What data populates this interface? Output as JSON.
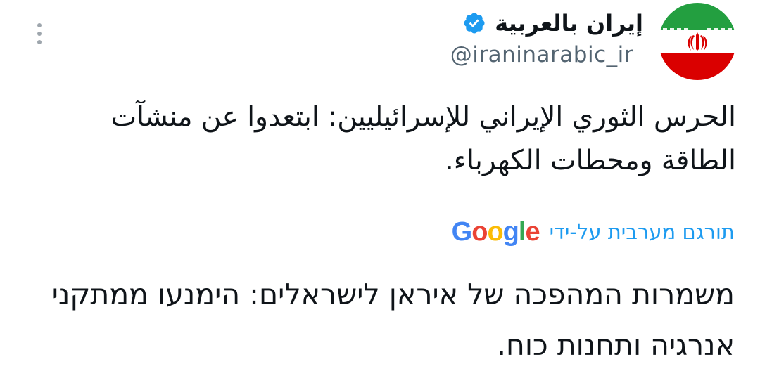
{
  "account": {
    "display_name": "إيران بالعربية",
    "handle": "@iraninarabic_ir",
    "verified": true,
    "avatar": "iran-flag-avatar"
  },
  "tweet": {
    "text": "الحرس الثوري الإيراني للإسرائيليين: ابتعدوا عن منشآت الطاقة ومحطات الكهرباء.",
    "translated_by_label": "תורגם מערבית על-ידי",
    "translation_provider": "Google",
    "translation": "משמרות המהפכה של איראן לישראלים: הימנעו ממתקני אנרגיה ותחנות כוח."
  },
  "icons": {
    "more": "more-vertical-icon",
    "verified": "verified-badge-icon"
  },
  "colors": {
    "link_blue": "#1d9bf0",
    "handle_gray": "#536471",
    "text": "#0f1419",
    "google_blue": "#4285F4",
    "google_red": "#EA4335",
    "google_yellow": "#FBBC05",
    "google_green": "#34A853",
    "flag_green": "#239f40",
    "flag_red": "#da0000"
  }
}
